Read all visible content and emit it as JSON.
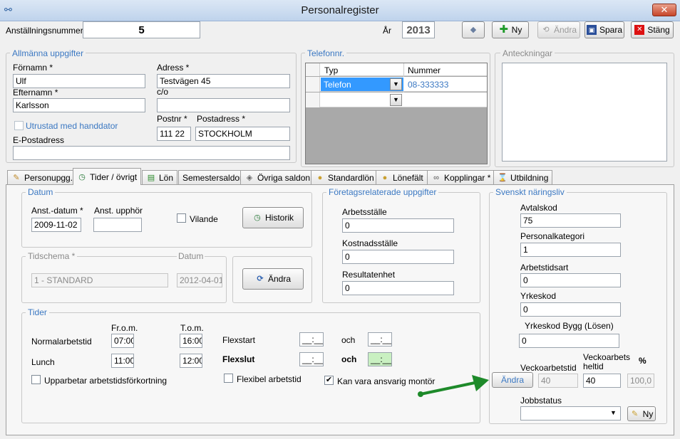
{
  "window": {
    "title": "Personalregister",
    "close_label": "✕"
  },
  "header": {
    "employee_number_label": "Anställningsnummer",
    "employee_number_value": "5",
    "year_label": "År",
    "year_value": "2013",
    "buttons": {
      "new": "Ny",
      "edit": "Ändra",
      "save": "Spara",
      "close": "Stäng"
    }
  },
  "general": {
    "title": "Allmänna uppgifter",
    "first_name_label": "Förnamn *",
    "first_name_value": "Ulf",
    "last_name_label": "Efternamn *",
    "last_name_value": "Karlsson",
    "handheld_label": "Utrustad med handdator",
    "email_label": "E-Postadress",
    "email_value": "",
    "address_label": "Adress *",
    "address_value": "Testvägen 45",
    "co_label": "c/o",
    "co_value": "",
    "postal_code_label": "Postnr *",
    "postal_code_value": "111 22",
    "postal_address_label": "Postadress *",
    "postal_address_value": "STOCKHOLM"
  },
  "phone": {
    "title": "Telefonnr.",
    "columns": [
      "Typ",
      "Nummer"
    ],
    "rows": [
      {
        "type": "Telefon",
        "number": "08-333333"
      }
    ]
  },
  "notes": {
    "title": "Anteckningar",
    "value": ""
  },
  "tabs": [
    {
      "label": "Personupgg.",
      "icon": "✎"
    },
    {
      "label": "Tider / övrigt",
      "icon": "◷"
    },
    {
      "label": "Lön",
      "icon": "▤"
    },
    {
      "label": "Semestersaldon",
      "icon": ""
    },
    {
      "label": "Övriga saldon",
      "icon": "◈"
    },
    {
      "label": "Standardlön",
      "icon": "●"
    },
    {
      "label": "Lönefält",
      "icon": "●"
    },
    {
      "label": "Kopplingar *",
      "icon": "∞"
    },
    {
      "label": "Utbildning",
      "icon": "⌛"
    }
  ],
  "datum": {
    "title": "Datum",
    "start_label": "Anst.-datum *",
    "start_value": "2009-11-02",
    "end_label": "Anst. upphör",
    "end_value": "",
    "idle_label": "Vilande",
    "history_button": "Historik"
  },
  "schedule": {
    "title": "Tidschema *",
    "date_label": "Datum",
    "schedule_value": "1 - STANDARD",
    "date_value": "2012-04-01",
    "change_button": "Ändra"
  },
  "company": {
    "title": "Företagsrelaterade uppgifter",
    "workplace_label": "Arbetsställe",
    "workplace_value": "0",
    "cost_center_label": "Kostnadsställe",
    "cost_center_value": "0",
    "result_unit_label": "Resultatenhet",
    "result_unit_value": "0"
  },
  "times": {
    "title": "Tider",
    "from_label": "Fr.o.m.",
    "to_label": "T.o.m.",
    "normal_label": "Normalarbetstid",
    "normal_from": "07:00",
    "normal_to": "16:00",
    "lunch_label": "Lunch",
    "lunch_from": "11:00",
    "lunch_to": "12:00",
    "flexstart_label": "Flexstart",
    "flexend_label": "Flexslut",
    "and_label": "och",
    "empty_time": "__:__",
    "shortening_label": "Upparbetar arbetstidsförkortning",
    "flexible_label": "Flexibel arbetstid",
    "fitter_label": "Kan vara ansvarig montör"
  },
  "industry": {
    "title": "Svenskt näringsliv",
    "agreement_label": "Avtalskod",
    "agreement_value": "75",
    "category_label": "Personalkategori",
    "category_value": "1",
    "worktime_type_label": "Arbetstidsart",
    "worktime_type_value": "0",
    "occupation_label": "Yrkeskod",
    "occupation_value": "0",
    "occupation_build_label": "Yrkeskod Bygg (Lösen)",
    "occupation_build_value": "0",
    "change_button": "Ändra",
    "weekly_label": "Veckoarbetstid",
    "weekly_value": "40",
    "weekly_full_label_1": "Veckoarbets",
    "weekly_full_label_2": "heltid",
    "weekly_full_value": "40",
    "percent_label": "%",
    "percent_value": "100,0",
    "job_status_label": "Jobbstatus",
    "job_status_value": "",
    "new_button": "Ny"
  },
  "colors": {
    "accent": "#3b78c2",
    "arrow": "#1e8a2a"
  }
}
